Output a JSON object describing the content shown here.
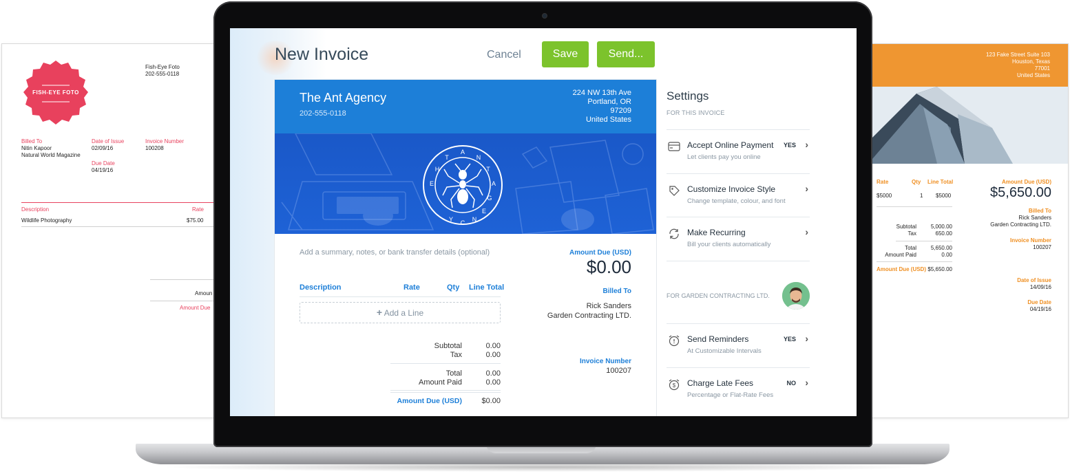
{
  "left_doc": {
    "badge_text": "FISH-EYE FOTO",
    "business_name": "Fish-Eye Foto",
    "business_phone": "202-555-0118",
    "billed_to_label": "Billed To",
    "billed_to_name": "Nitin Kapoor",
    "billed_to_company": "Natural World Magazine",
    "date_of_issue_label": "Date of Issue",
    "date_of_issue": "02/09/16",
    "due_date_label": "Due Date",
    "due_date": "04/19/16",
    "invoice_number_label": "Invoice Number",
    "invoice_number": "100208",
    "description_label": "Description",
    "rate_label": "Rate",
    "item_description": "Wildlife Photography",
    "item_rate": "$75.00",
    "amount_partial": "Amoun",
    "amount_due_label": "Amount Due"
  },
  "right_doc": {
    "address": [
      "123 Fake Street Suite 103",
      "Houston, Texas",
      "77001",
      "United States"
    ],
    "rate_label": "Rate",
    "qty_label": "Qty",
    "line_total_label": "Line Total",
    "item_rate": "$5000",
    "item_qty": "1",
    "item_total": "$5000",
    "subtotal_label": "Subtotal",
    "subtotal": "5,000.00",
    "tax_label": "Tax",
    "tax": "650.00",
    "total_label": "Total",
    "total": "5,650.00",
    "amount_paid_label": "Amount Paid",
    "amount_paid": "0.00",
    "amount_due_label": "Amount Due (USD)",
    "amount_due_small": "$5,650.00",
    "amount_due_big": "$5,650.00",
    "billed_to_label": "Billed To",
    "billed_to_name": "Rick Sanders",
    "billed_to_company": "Garden Contracting LTD.",
    "invoice_number_label": "Invoice Number",
    "invoice_number": "100207",
    "date_of_issue_label": "Date of Issue",
    "date_of_issue": "14/09/16",
    "due_date_label": "Due Date",
    "due_date": "04/19/16"
  },
  "header": {
    "title": "New Invoice",
    "cancel_label": "Cancel",
    "save_label": "Save",
    "send_label": "Send..."
  },
  "invoice": {
    "business_name": "The Ant Agency",
    "business_phone": "202-555-0118",
    "address": [
      "224 NW 13th Ave",
      "Portland, OR",
      "97209",
      "United States"
    ],
    "logo_text": "THE ANT AGENCY",
    "summary_placeholder": "Add a summary, notes, or bank transfer details (optional)",
    "amount_due_label": "Amount Due (USD)",
    "amount_due": "$0.00",
    "columns": [
      "Description",
      "Rate",
      "Qty",
      "Line Total"
    ],
    "add_line_label": "Add a Line",
    "billed_to_label": "Billed To",
    "billed_to_name": "Rick Sanders",
    "billed_to_company": "Garden Contracting LTD.",
    "invoice_number_label": "Invoice Number",
    "invoice_number": "100207",
    "subtotal_label": "Subtotal",
    "subtotal": "0.00",
    "tax_label": "Tax",
    "tax": "0.00",
    "total_label": "Total",
    "total": "0.00",
    "amount_paid_label": "Amount Paid",
    "amount_paid": "0.00",
    "amount_due_row_label": "Amount Due (USD)",
    "amount_due_row": "$0.00"
  },
  "settings": {
    "title": "Settings",
    "for_invoice_label": "FOR THIS INVOICE",
    "items": [
      {
        "name": "Accept Online Payment",
        "desc": "Let clients pay you online",
        "state": "YES",
        "icon": "credit-card-icon"
      },
      {
        "name": "Customize Invoice Style",
        "desc": "Change template, colour, and font",
        "state": "",
        "icon": "paint-tag-icon"
      },
      {
        "name": "Make Recurring",
        "desc": "Bill your clients automatically",
        "state": "",
        "icon": "recurring-icon"
      }
    ],
    "client_label": "FOR GARDEN CONTRACTING LTD.",
    "client_items": [
      {
        "name": "Send Reminders",
        "desc": "At Customizable Intervals",
        "state": "YES",
        "icon": "alarm-clock-icon"
      },
      {
        "name": "Charge Late Fees",
        "desc": "Percentage or Flat-Rate Fees",
        "state": "NO",
        "icon": "dollar-clock-icon"
      }
    ]
  },
  "colors": {
    "green": "#7cc32c",
    "blue": "#1d7fd8",
    "red": "#e8415d",
    "orange": "#ef9631"
  }
}
